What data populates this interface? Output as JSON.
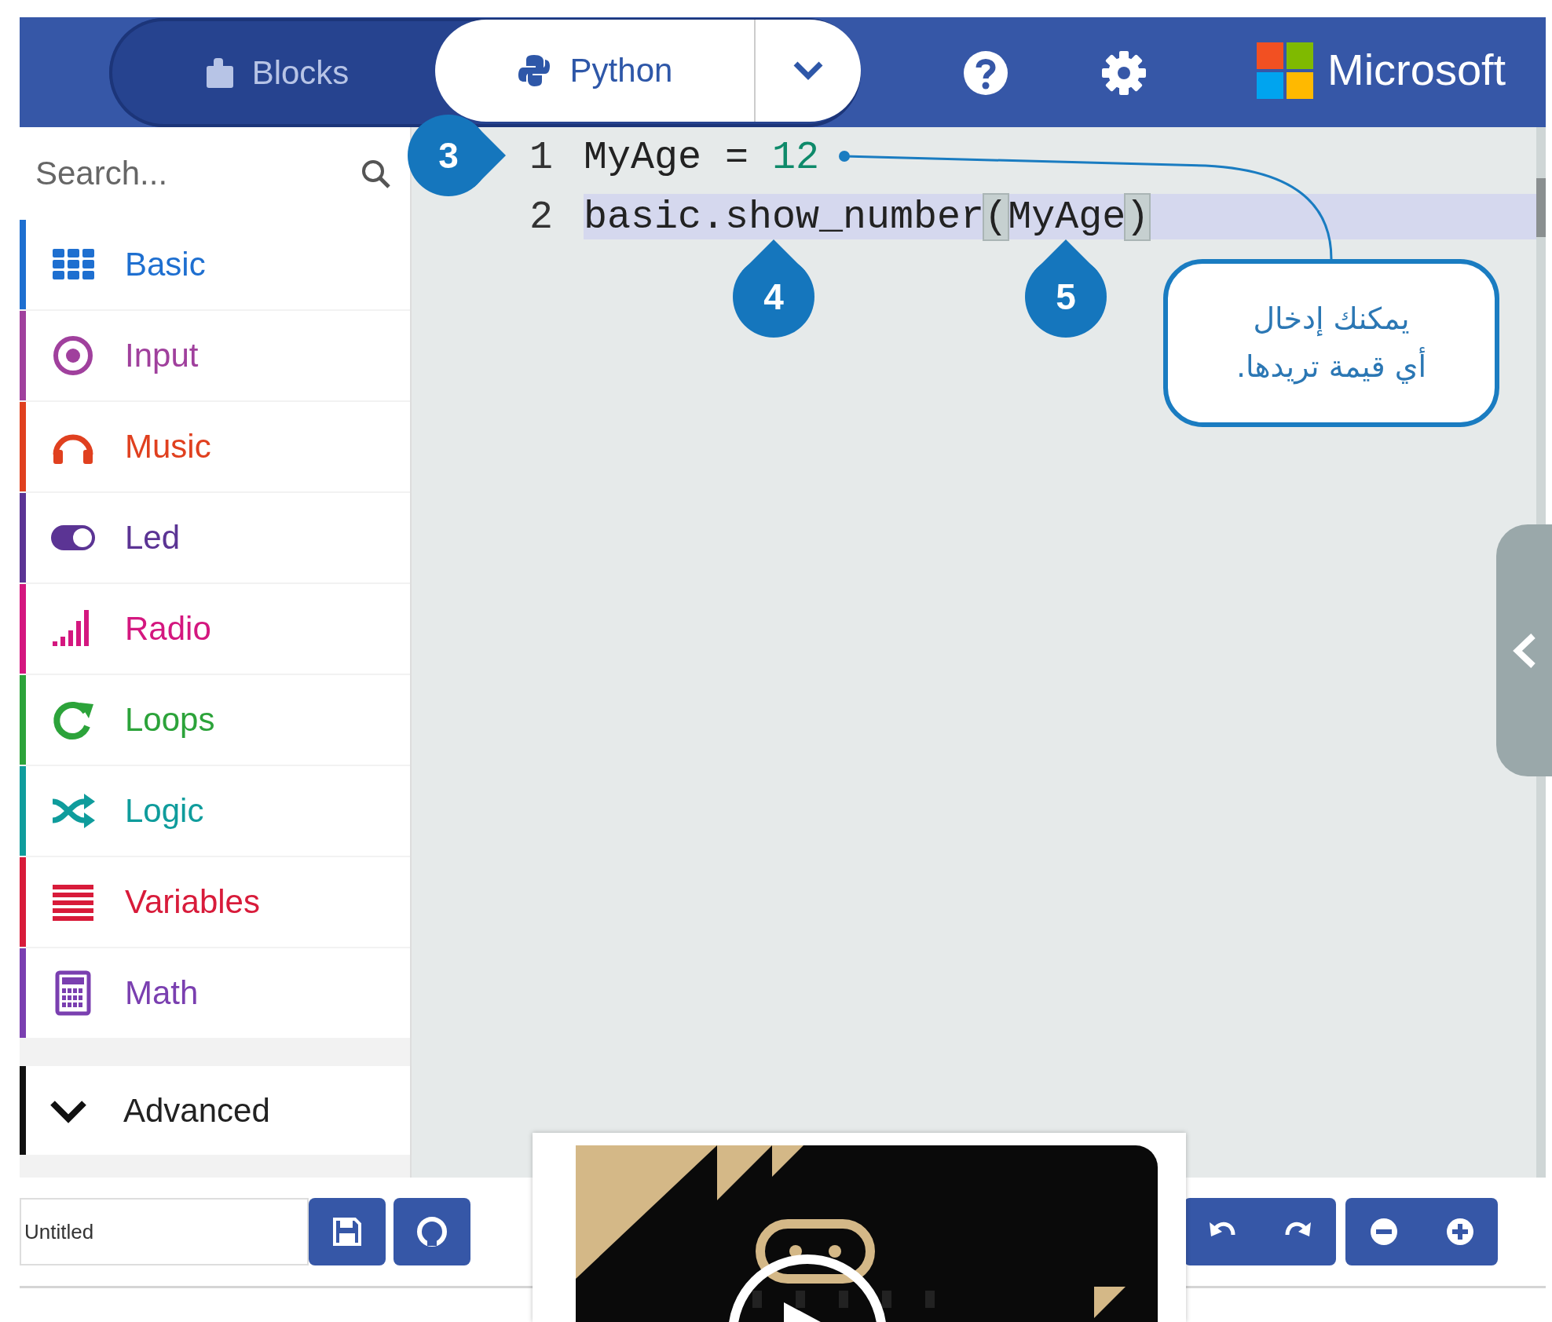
{
  "header": {
    "tabs": [
      {
        "label": "Blocks",
        "selected": false
      },
      {
        "label": "Python",
        "selected": true
      }
    ],
    "brand": "Microsoft"
  },
  "sidebar": {
    "search": {
      "placeholder": "Search..."
    },
    "categories": [
      {
        "label": "Basic",
        "color": "#1e6fd0"
      },
      {
        "label": "Input",
        "color": "#a0409d"
      },
      {
        "label": "Music",
        "color": "#e0401f"
      },
      {
        "label": "Led",
        "color": "#5b3494"
      },
      {
        "label": "Radio",
        "color": "#d4177f"
      },
      {
        "label": "Loops",
        "color": "#2ca33a"
      },
      {
        "label": "Logic",
        "color": "#0f9c9c"
      },
      {
        "label": "Variables",
        "color": "#d81b3a"
      },
      {
        "label": "Math",
        "color": "#7a3fb0"
      }
    ],
    "advanced": {
      "label": "Advanced",
      "expanded": false
    }
  },
  "editor": {
    "lines": [
      {
        "number": "1",
        "highlighted": false,
        "tokens": [
          {
            "text": "MyAge = ",
            "kind": "plain"
          },
          {
            "text": "12",
            "kind": "number"
          }
        ]
      },
      {
        "number": "2",
        "highlighted": true,
        "tokens": [
          {
            "text": "basic.show_number",
            "kind": "plain"
          },
          {
            "text": "(",
            "kind": "bracket"
          },
          {
            "text": "MyAge",
            "kind": "plain"
          },
          {
            "text": ")",
            "kind": "bracket"
          }
        ]
      }
    ]
  },
  "annotations": {
    "markers": [
      "3",
      "4",
      "5"
    ],
    "note": "يمكنك إدخال\nأي قيمة تريدها."
  },
  "bottom_bar": {
    "project_name": "Untitled"
  }
}
